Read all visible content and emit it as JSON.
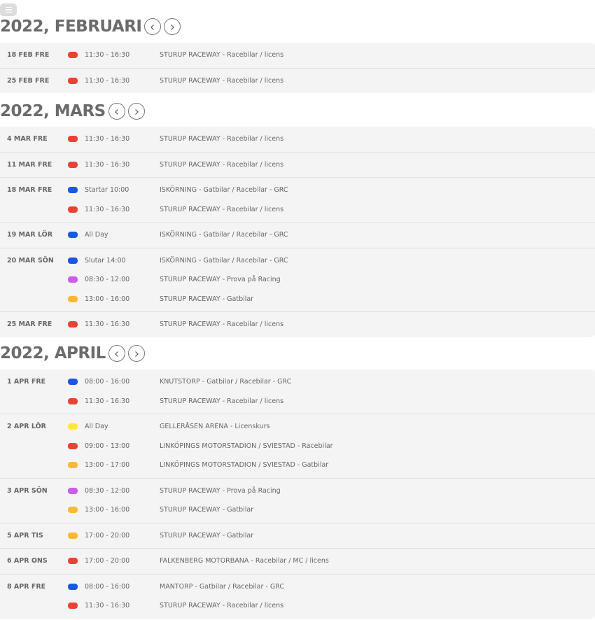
{
  "colors": {
    "red": "#ea4335",
    "blue": "#1a56e8",
    "purple": "#cc5de8",
    "orange": "#fbb832",
    "yellow": "#fde933"
  },
  "icons": {
    "menu": "hamburger-menu-icon",
    "prev": "chevron-left-icon",
    "next": "chevron-right-icon"
  },
  "months": [
    {
      "title": "2022, FEBRUARI",
      "days": [
        {
          "label": "18 FEB FRE",
          "events": [
            {
              "color": "red",
              "time": "11:30 - 16:30",
              "title": "STURUP RACEWAY - Racebilar / licens"
            }
          ]
        },
        {
          "label": "25 FEB FRE",
          "events": [
            {
              "color": "red",
              "time": "11:30 - 16:30",
              "title": "STURUP RACEWAY - Racebilar / licens"
            }
          ]
        }
      ]
    },
    {
      "title": "2022, MARS",
      "days": [
        {
          "label": "4 MAR FRE",
          "events": [
            {
              "color": "red",
              "time": "11:30 - 16:30",
              "title": "STURUP RACEWAY - Racebilar / licens"
            }
          ]
        },
        {
          "label": "11 MAR FRE",
          "events": [
            {
              "color": "red",
              "time": "11:30 - 16:30",
              "title": "STURUP RACEWAY - Racebilar / licens"
            }
          ]
        },
        {
          "label": "18 MAR FRE",
          "events": [
            {
              "color": "blue",
              "time": "Startar 10:00",
              "title": "ISKÖRNING - Gatbilar / Racebilar - GRC"
            },
            {
              "color": "red",
              "time": "11:30 - 16:30",
              "title": "STURUP RACEWAY - Racebilar / licens"
            }
          ]
        },
        {
          "label": "19 MAR LÖR",
          "events": [
            {
              "color": "blue",
              "time": "All Day",
              "title": "ISKÖRNING - Gatbilar / Racebilar - GRC"
            }
          ]
        },
        {
          "label": "20 MAR SÖN",
          "events": [
            {
              "color": "blue",
              "time": "Slutar 14:00",
              "title": "ISKÖRNING - Gatbilar / Racebilar - GRC"
            },
            {
              "color": "purple",
              "time": "08:30 - 12:00",
              "title": "STURUP RACEWAY - Prova på Racing"
            },
            {
              "color": "orange",
              "time": "13:00 - 16:00",
              "title": "STURUP RACEWAY - Gatbilar"
            }
          ]
        },
        {
          "label": "25 MAR FRE",
          "events": [
            {
              "color": "red",
              "time": "11:30 - 16:30",
              "title": "STURUP RACEWAY - Racebilar / licens"
            }
          ]
        }
      ]
    },
    {
      "title": "2022, APRIL",
      "days": [
        {
          "label": "1 APR FRE",
          "events": [
            {
              "color": "blue",
              "time": "08:00 - 16:00",
              "title": "KNUTSTORP - Gatbilar / Racebilar - GRC"
            },
            {
              "color": "red",
              "time": "11:30 - 16:30",
              "title": "STURUP RACEWAY - Racebilar / licens"
            }
          ]
        },
        {
          "label": "2 APR LÖR",
          "events": [
            {
              "color": "yellow",
              "time": "All Day",
              "title": "GELLERÅSEN ARENA - Licenskurs"
            },
            {
              "color": "red",
              "time": "09:00 - 13:00",
              "title": "LINKÖPINGS MOTORSTADION / SVIESTAD - Racebilar"
            },
            {
              "color": "orange",
              "time": "13:00 - 17:00",
              "title": "LINKÖPINGS MOTORSTADION / SVIESTAD - Gatbilar"
            }
          ]
        },
        {
          "label": "3 APR SÖN",
          "events": [
            {
              "color": "purple",
              "time": "08:30 - 12:00",
              "title": "STURUP RACEWAY - Prova på Racing"
            },
            {
              "color": "orange",
              "time": "13:00 - 16:00",
              "title": "STURUP RACEWAY - Gatbilar"
            }
          ]
        },
        {
          "label": "5 APR TIS",
          "events": [
            {
              "color": "orange",
              "time": "17:00 - 20:00",
              "title": "STURUP RACEWAY - Gatbilar"
            }
          ]
        },
        {
          "label": "6 APR ONS",
          "events": [
            {
              "color": "red",
              "time": "17:00 - 20:00",
              "title": "FALKENBERG MOTORBANA - Racebilar / MC / licens"
            }
          ]
        },
        {
          "label": "8 APR FRE",
          "events": [
            {
              "color": "blue",
              "time": "08:00 - 16:00",
              "title": "MANTORP - Gatbilar / Racebilar - GRC"
            },
            {
              "color": "red",
              "time": "11:30 - 16:30",
              "title": "STURUP RACEWAY - Racebilar / licens"
            }
          ]
        }
      ]
    }
  ]
}
